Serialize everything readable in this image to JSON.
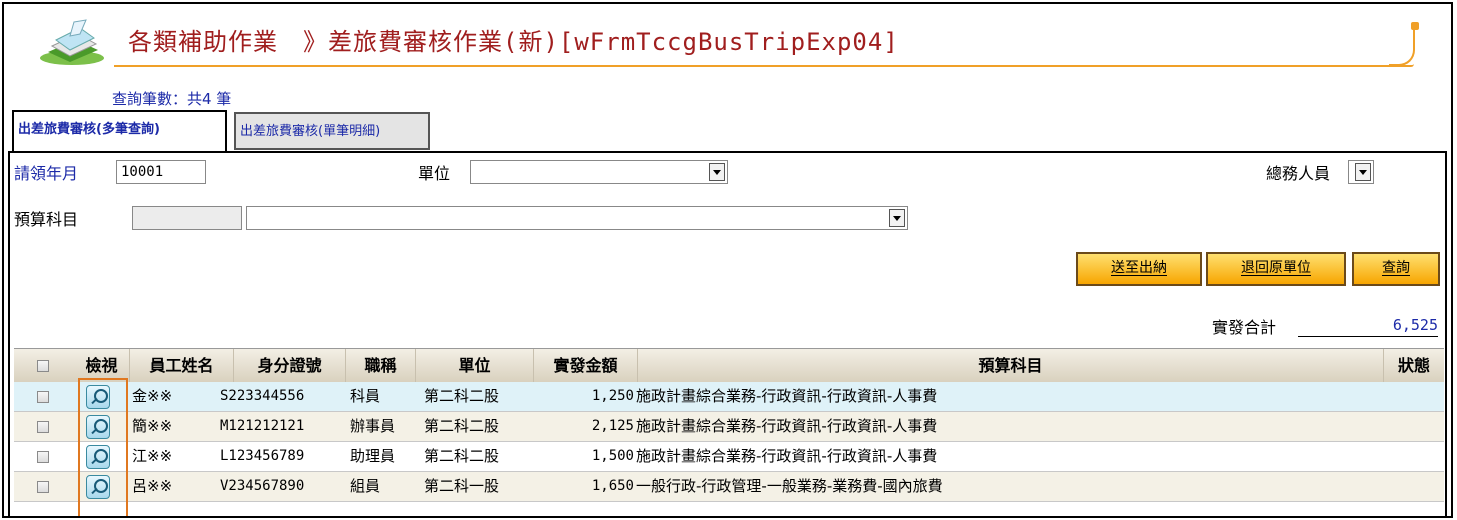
{
  "header": {
    "title": "各類補助作業　》差旅費審核作業(新)[wFrmTccgBusTripExp04]",
    "count_text": "查詢筆數：共4 筆"
  },
  "tabs": [
    {
      "label": "出差旅費審核(多筆查詢)",
      "active": true
    },
    {
      "label": "出差旅費審核(單筆明細)",
      "active": false
    }
  ],
  "form": {
    "period_label": "請領年月",
    "period_value": "10001",
    "unit_label": "單位",
    "unit_value": "",
    "staff_label": "總務人員",
    "staff_value": "",
    "budget_label": "預算科目",
    "budget_code": "",
    "budget_value": ""
  },
  "buttons": {
    "send": "送至出納",
    "return": "退回原單位",
    "query": "查詢"
  },
  "total": {
    "label": "實發合計",
    "value": "6,525"
  },
  "table": {
    "headers": [
      "檢視",
      "員工姓名",
      "身分證號",
      "職稱",
      "單位",
      "實發金額",
      "預算科目",
      "狀態"
    ],
    "rows": [
      {
        "name": "金※※",
        "id": "S223344556",
        "title": "科員",
        "unit": "第二科二股",
        "amount": "1,250",
        "budget": "施政計畫綜合業務-行政資訊-行政資訊-人事費",
        "status": ""
      },
      {
        "name": "簡※※",
        "id": "M121212121",
        "title": "辦事員",
        "unit": "第二科二股",
        "amount": "2,125",
        "budget": "施政計畫綜合業務-行政資訊-行政資訊-人事費",
        "status": ""
      },
      {
        "name": "江※※",
        "id": "L123456789",
        "title": "助理員",
        "unit": "第二科二股",
        "amount": "1,500",
        "budget": "施政計畫綜合業務-行政資訊-行政資訊-人事費",
        "status": ""
      },
      {
        "name": "呂※※",
        "id": "V234567890",
        "title": "組員",
        "unit": "第二科一股",
        "amount": "1,650",
        "budget": "一般行政-行政管理-一般業務-業務費-國內旅費",
        "status": ""
      }
    ]
  },
  "colors": {
    "title_red": "#a01e1e",
    "link_blue": "#1c2aa8",
    "accent_orange": "#f0a028",
    "button_gold": "#f7a500"
  }
}
